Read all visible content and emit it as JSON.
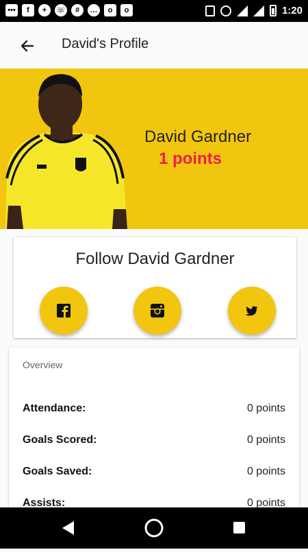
{
  "status_bar": {
    "time": "1:20",
    "notification_icons": [
      "chat-icon",
      "facebook-icon",
      "add-person-icon",
      "whatsapp-icon",
      "slack-icon",
      "message-icon",
      "outlook-icon",
      "outlook-icon"
    ],
    "system_icons": [
      "vibrate-icon",
      "alarm-icon",
      "wifi-icon",
      "signal-icon",
      "battery-icon"
    ]
  },
  "app_bar": {
    "title": "David's Profile",
    "back_icon": "back-arrow-icon"
  },
  "hero": {
    "name": "David Gardner",
    "points": "1 points",
    "background_color": "#f2c50f",
    "points_color": "#ea1f4f"
  },
  "follow": {
    "title": "Follow David Gardner",
    "buttons": [
      {
        "icon": "facebook-icon"
      },
      {
        "icon": "instagram-icon"
      },
      {
        "icon": "twitter-icon"
      }
    ]
  },
  "overview": {
    "title": "Overview",
    "rows": [
      {
        "label": "Attendance:",
        "value": "0 points"
      },
      {
        "label": "Goals Scored:",
        "value": "0 points"
      },
      {
        "label": "Goals Saved:",
        "value": "0 points"
      },
      {
        "label": "Assists:",
        "value": "0 points"
      }
    ]
  },
  "nav_bar": {
    "buttons": [
      "back-triangle-icon",
      "home-circle-icon",
      "recents-square-icon"
    ]
  }
}
